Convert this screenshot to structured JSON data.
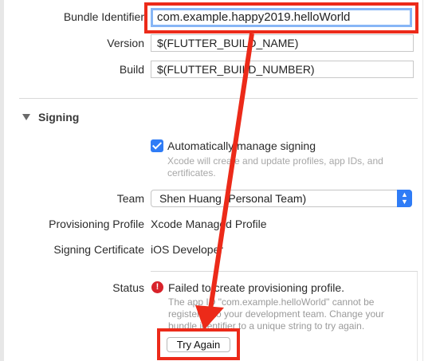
{
  "identity": {
    "bundle_identifier_label": "Bundle Identifier",
    "bundle_identifier_value": "com.example.happy2019.helloWorld",
    "version_label": "Version",
    "version_value": "$(FLUTTER_BUILD_NAME)",
    "build_label": "Build",
    "build_value": "$(FLUTTER_BUILD_NUMBER)"
  },
  "signing": {
    "section_title": "Signing",
    "auto_manage_label": "Automatically manage signing",
    "auto_manage_checked": true,
    "auto_manage_hint_line1": "Xcode will create and update profiles, app IDs, and",
    "auto_manage_hint_line2": "certificates.",
    "team_label": "Team",
    "team_value": "Shen Huang (Personal Team)",
    "profile_label": "Provisioning Profile",
    "profile_value": "Xcode Managed Profile",
    "certificate_label": "Signing Certificate",
    "certificate_value": "iOS Developer",
    "status_label": "Status",
    "status_title": "Failed to create provisioning profile.",
    "status_detail_line1": "The app ID \"com.example.helloWorld\" cannot be",
    "status_detail_line2": "registered to your development team. Change your",
    "status_detail_line3": "bundle identifier to a unique string to try again.",
    "try_again_label": "Try Again"
  },
  "icons": {
    "disclosure": "disclosure-triangle-icon",
    "checkbox": "checkmark-icon",
    "popup": "chevron-updown-icon",
    "error": "error-icon"
  },
  "colors": {
    "annotation_red": "#ec2a19",
    "accent_blue": "#2f7cf6",
    "error_red": "#d8222a"
  }
}
